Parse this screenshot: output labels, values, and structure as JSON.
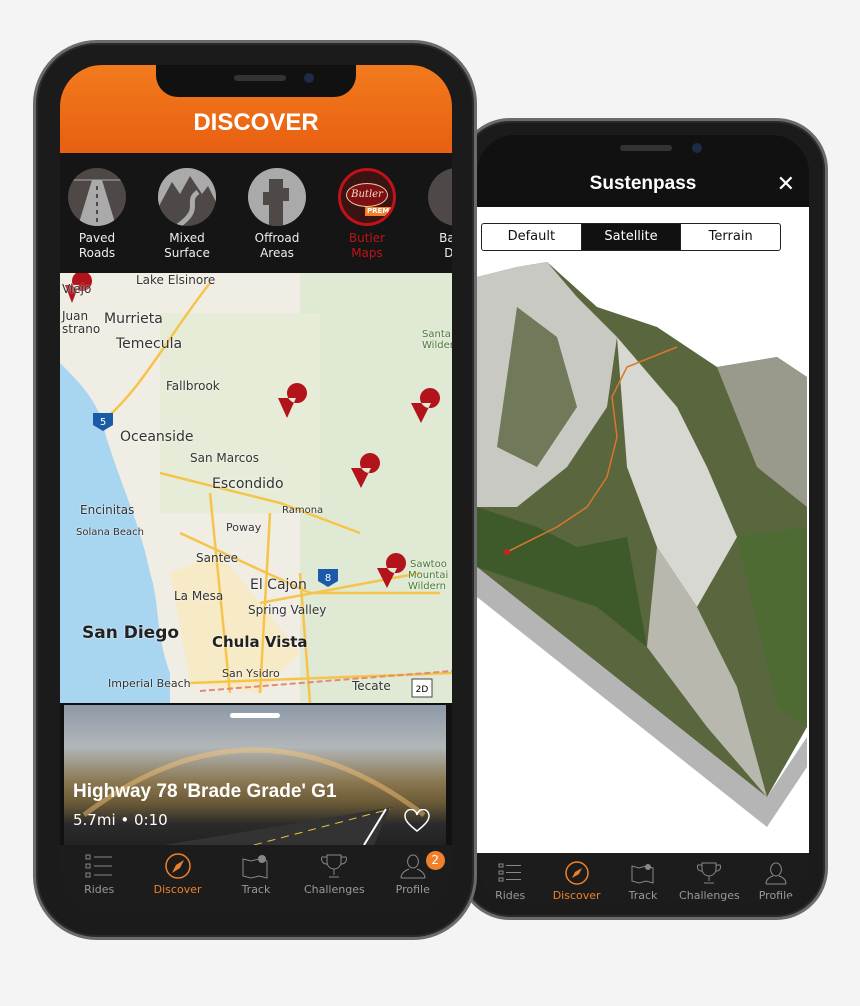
{
  "left_phone": {
    "header": {
      "title": "DISCOVER"
    },
    "categories": [
      {
        "label1": "Paved",
        "label2": "Roads",
        "icon": "paved-road-icon"
      },
      {
        "label1": "Mixed",
        "label2": "Surface",
        "icon": "mountain-road-icon"
      },
      {
        "label1": "Offroad",
        "label2": "Areas",
        "icon": "cactus-icon"
      },
      {
        "label1": "Butler",
        "label2": "Maps",
        "icon": "butler-logo",
        "selected": true,
        "logo_text": "Butler",
        "badge": "PREMIUM"
      },
      {
        "label1": "Backc",
        "label2": "Disc",
        "icon": "backcountry-icon"
      }
    ],
    "map": {
      "labels": [
        "Lake Elsinore",
        "Viejo",
        "Juan",
        "strano",
        "Murrieta",
        "Temecula",
        "Fallbrook",
        "Oceanside",
        "San Marcos",
        "Escondido",
        "Ramona",
        "Encinitas",
        "Solana Beach",
        "Poway",
        "Santee",
        "El Cajon",
        "La Mesa",
        "Spring Valley",
        "San Diego",
        "Chula Vista",
        "San Ysidro",
        "Imperial Beach",
        "Tecate",
        "Santa",
        "Wilder",
        "Sawtoo",
        "Mountai",
        "Wildern"
      ],
      "shields": [
        "5",
        "8",
        "2D"
      ]
    },
    "card": {
      "title": "Highway 78 'Brade Grade' G1",
      "subtitle": "5.7mi • 0:10"
    },
    "tabs": [
      {
        "label": "Rides"
      },
      {
        "label": "Discover",
        "active": true
      },
      {
        "label": "Track"
      },
      {
        "label": "Challenges"
      },
      {
        "label": "Profile",
        "badge": "2"
      }
    ]
  },
  "right_phone": {
    "header": {
      "title": "Sustenpass",
      "close": "✕"
    },
    "segments": [
      {
        "label": "Default"
      },
      {
        "label": "Satellite",
        "active": true
      },
      {
        "label": "Terrain"
      }
    ],
    "tabs": [
      {
        "label": "Rides"
      },
      {
        "label": "Discover",
        "active": true
      },
      {
        "label": "Track"
      },
      {
        "label": "Challenges"
      },
      {
        "label": "Profile"
      }
    ]
  },
  "colors": {
    "accent": "#f0812a",
    "header_orange": "#ec6a16",
    "butler_red": "#c0121a",
    "pin_red": "#b3141c"
  }
}
